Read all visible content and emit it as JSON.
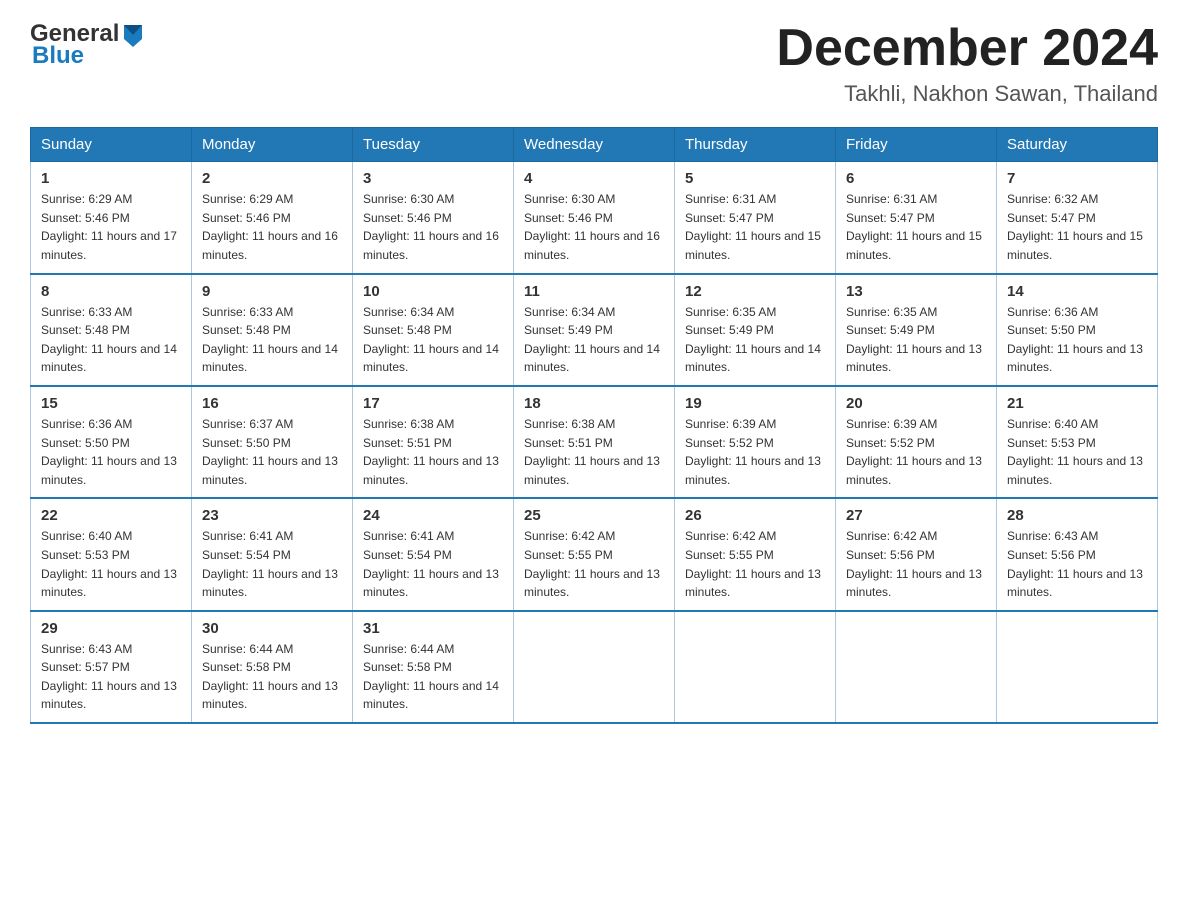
{
  "header": {
    "logo": {
      "general": "General",
      "blue": "Blue"
    },
    "title": "December 2024",
    "location": "Takhli, Nakhon Sawan, Thailand"
  },
  "weekdays": [
    "Sunday",
    "Monday",
    "Tuesday",
    "Wednesday",
    "Thursday",
    "Friday",
    "Saturday"
  ],
  "weeks": [
    [
      {
        "day": "1",
        "sunrise": "6:29 AM",
        "sunset": "5:46 PM",
        "daylight": "11 hours and 17 minutes."
      },
      {
        "day": "2",
        "sunrise": "6:29 AM",
        "sunset": "5:46 PM",
        "daylight": "11 hours and 16 minutes."
      },
      {
        "day": "3",
        "sunrise": "6:30 AM",
        "sunset": "5:46 PM",
        "daylight": "11 hours and 16 minutes."
      },
      {
        "day": "4",
        "sunrise": "6:30 AM",
        "sunset": "5:46 PM",
        "daylight": "11 hours and 16 minutes."
      },
      {
        "day": "5",
        "sunrise": "6:31 AM",
        "sunset": "5:47 PM",
        "daylight": "11 hours and 15 minutes."
      },
      {
        "day": "6",
        "sunrise": "6:31 AM",
        "sunset": "5:47 PM",
        "daylight": "11 hours and 15 minutes."
      },
      {
        "day": "7",
        "sunrise": "6:32 AM",
        "sunset": "5:47 PM",
        "daylight": "11 hours and 15 minutes."
      }
    ],
    [
      {
        "day": "8",
        "sunrise": "6:33 AM",
        "sunset": "5:48 PM",
        "daylight": "11 hours and 14 minutes."
      },
      {
        "day": "9",
        "sunrise": "6:33 AM",
        "sunset": "5:48 PM",
        "daylight": "11 hours and 14 minutes."
      },
      {
        "day": "10",
        "sunrise": "6:34 AM",
        "sunset": "5:48 PM",
        "daylight": "11 hours and 14 minutes."
      },
      {
        "day": "11",
        "sunrise": "6:34 AM",
        "sunset": "5:49 PM",
        "daylight": "11 hours and 14 minutes."
      },
      {
        "day": "12",
        "sunrise": "6:35 AM",
        "sunset": "5:49 PM",
        "daylight": "11 hours and 14 minutes."
      },
      {
        "day": "13",
        "sunrise": "6:35 AM",
        "sunset": "5:49 PM",
        "daylight": "11 hours and 13 minutes."
      },
      {
        "day": "14",
        "sunrise": "6:36 AM",
        "sunset": "5:50 PM",
        "daylight": "11 hours and 13 minutes."
      }
    ],
    [
      {
        "day": "15",
        "sunrise": "6:36 AM",
        "sunset": "5:50 PM",
        "daylight": "11 hours and 13 minutes."
      },
      {
        "day": "16",
        "sunrise": "6:37 AM",
        "sunset": "5:50 PM",
        "daylight": "11 hours and 13 minutes."
      },
      {
        "day": "17",
        "sunrise": "6:38 AM",
        "sunset": "5:51 PM",
        "daylight": "11 hours and 13 minutes."
      },
      {
        "day": "18",
        "sunrise": "6:38 AM",
        "sunset": "5:51 PM",
        "daylight": "11 hours and 13 minutes."
      },
      {
        "day": "19",
        "sunrise": "6:39 AM",
        "sunset": "5:52 PM",
        "daylight": "11 hours and 13 minutes."
      },
      {
        "day": "20",
        "sunrise": "6:39 AM",
        "sunset": "5:52 PM",
        "daylight": "11 hours and 13 minutes."
      },
      {
        "day": "21",
        "sunrise": "6:40 AM",
        "sunset": "5:53 PM",
        "daylight": "11 hours and 13 minutes."
      }
    ],
    [
      {
        "day": "22",
        "sunrise": "6:40 AM",
        "sunset": "5:53 PM",
        "daylight": "11 hours and 13 minutes."
      },
      {
        "day": "23",
        "sunrise": "6:41 AM",
        "sunset": "5:54 PM",
        "daylight": "11 hours and 13 minutes."
      },
      {
        "day": "24",
        "sunrise": "6:41 AM",
        "sunset": "5:54 PM",
        "daylight": "11 hours and 13 minutes."
      },
      {
        "day": "25",
        "sunrise": "6:42 AM",
        "sunset": "5:55 PM",
        "daylight": "11 hours and 13 minutes."
      },
      {
        "day": "26",
        "sunrise": "6:42 AM",
        "sunset": "5:55 PM",
        "daylight": "11 hours and 13 minutes."
      },
      {
        "day": "27",
        "sunrise": "6:42 AM",
        "sunset": "5:56 PM",
        "daylight": "11 hours and 13 minutes."
      },
      {
        "day": "28",
        "sunrise": "6:43 AM",
        "sunset": "5:56 PM",
        "daylight": "11 hours and 13 minutes."
      }
    ],
    [
      {
        "day": "29",
        "sunrise": "6:43 AM",
        "sunset": "5:57 PM",
        "daylight": "11 hours and 13 minutes."
      },
      {
        "day": "30",
        "sunrise": "6:44 AM",
        "sunset": "5:58 PM",
        "daylight": "11 hours and 13 minutes."
      },
      {
        "day": "31",
        "sunrise": "6:44 AM",
        "sunset": "5:58 PM",
        "daylight": "11 hours and 14 minutes."
      },
      null,
      null,
      null,
      null
    ]
  ]
}
